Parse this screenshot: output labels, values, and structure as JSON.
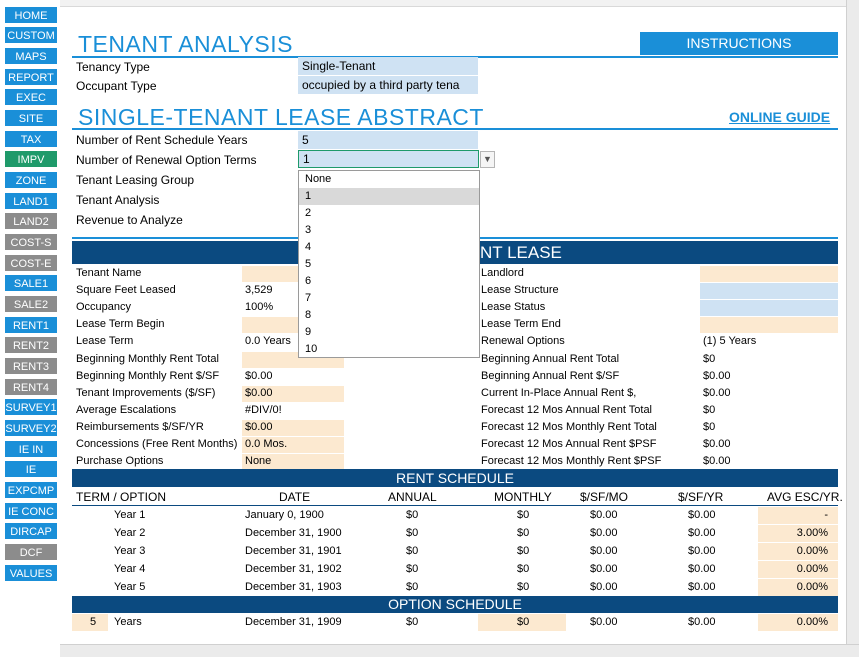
{
  "nav": [
    "HOME",
    "CUSTOM",
    "MAPS",
    "REPORT",
    "EXEC",
    "SITE",
    "TAX",
    "IMPV",
    "ZONE",
    "LAND1",
    "LAND2",
    "COST-S",
    "COST-E",
    "SALE1",
    "SALE2",
    "RENT1",
    "RENT2",
    "RENT3",
    "RENT4",
    "SURVEY1",
    "SURVEY2",
    "IE IN",
    "IE",
    "EXPCMP",
    "IE CONC",
    "DIRCAP",
    "DCF",
    "VALUES"
  ],
  "colors": {
    "accent": "#1a8fd8",
    "band": "#0b4a80",
    "gray": "#8c8c8c",
    "green": "#1f9a6a",
    "input_blue": "#cfe2f3",
    "input_tan": "#fce9d0"
  },
  "tenant_analysis": {
    "title": "TENANT ANALYSIS",
    "instructions": "INSTRUCTIONS",
    "tenancy_type_label": "Tenancy Type",
    "tenancy_type_value": "Single-Tenant",
    "occupant_type_label": "Occupant Type",
    "occupant_type_value": "occupied by a third party tena"
  },
  "abstract": {
    "title": "SINGLE-TENANT LEASE ABSTRACT",
    "online_guide": "ONLINE GUIDE",
    "rent_years_label": "Number of Rent Schedule Years",
    "rent_years_value": "5",
    "renewal_terms_label": "Number of Renewal Option Terms",
    "renewal_terms_value": "1",
    "leasing_group_label": "Tenant Leasing Group",
    "tenant_analysis_label": "Tenant Analysis",
    "revenue_label": "Revenue to Analyze"
  },
  "dropdown": {
    "options": [
      "None",
      "1",
      "2",
      "3",
      "4",
      "5",
      "6",
      "7",
      "8",
      "9",
      "10"
    ],
    "selected": "1"
  },
  "lease_band": "NT LEASE",
  "left_fields": [
    {
      "label": "Tenant Name",
      "value": ""
    },
    {
      "label": "Square Feet Leased",
      "value": "3,529"
    },
    {
      "label": "Occupancy",
      "value": "100%"
    },
    {
      "label": "Lease Term Begin",
      "value": ""
    },
    {
      "label": "Lease Term",
      "value": "0.0 Years"
    },
    {
      "label": "Beginning Monthly Rent Total",
      "value": ""
    },
    {
      "label": "Beginning Monthly Rent $/SF",
      "value": "$0.00"
    },
    {
      "label": "Tenant Improvements ($/SF)",
      "value": "$0.00"
    },
    {
      "label": "Average Escalations",
      "value": "#DIV/0!"
    },
    {
      "label": "Reimbursements $/SF/YR",
      "value": "$0.00"
    },
    {
      "label": "Concessions (Free Rent Months)",
      "value": "0.0 Mos."
    },
    {
      "label": "Purchase Options",
      "value": "None"
    }
  ],
  "right_fields": [
    {
      "label": "Landlord",
      "value": ""
    },
    {
      "label": "Lease Structure",
      "value": ""
    },
    {
      "label": "Lease Status",
      "value": ""
    },
    {
      "label": "Lease Term End",
      "value": ""
    },
    {
      "label": "Renewal Options",
      "value": "(1) 5 Years"
    },
    {
      "label": "Beginning Annual Rent Total",
      "value": "$0"
    },
    {
      "label": "Beginning Annual Rent $/SF",
      "value": "$0.00"
    },
    {
      "label": "Current In-Place Annual Rent $,",
      "value": "$0.00"
    },
    {
      "label": "Forecast 12 Mos Annual Rent Total",
      "value": "$0"
    },
    {
      "label": "Forecast 12 Mos Monthly Rent Total",
      "value": "$0"
    },
    {
      "label": "Forecast 12 Mos Annual Rent $PSF",
      "value": "$0.00"
    },
    {
      "label": "Forecast 12 Mos Monthly Rent $PSF",
      "value": "$0.00"
    }
  ],
  "rent_schedule": {
    "title": "RENT SCHEDULE",
    "headers": [
      "TERM / OPTION",
      "DATE",
      "ANNUAL",
      "MONTHLY",
      "$/SF/MO",
      "$/SF/YR",
      "AVG ESC/YR."
    ],
    "rows": [
      {
        "term": "",
        "label": "Year 1",
        "date": "January 0, 1900",
        "annual": "$0",
        "monthly": "$0",
        "sfmo": "$0.00",
        "sfyr": "$0.00",
        "esc": "-"
      },
      {
        "term": "",
        "label": "Year 2",
        "date": "December 31, 1900",
        "annual": "$0",
        "monthly": "$0",
        "sfmo": "$0.00",
        "sfyr": "$0.00",
        "esc": "3.00%"
      },
      {
        "term": "",
        "label": "Year 3",
        "date": "December 31, 1901",
        "annual": "$0",
        "monthly": "$0",
        "sfmo": "$0.00",
        "sfyr": "$0.00",
        "esc": "0.00%"
      },
      {
        "term": "",
        "label": "Year 4",
        "date": "December 31, 1902",
        "annual": "$0",
        "monthly": "$0",
        "sfmo": "$0.00",
        "sfyr": "$0.00",
        "esc": "0.00%"
      },
      {
        "term": "",
        "label": "Year 5",
        "date": "December 31, 1903",
        "annual": "$0",
        "monthly": "$0",
        "sfmo": "$0.00",
        "sfyr": "$0.00",
        "esc": "0.00%"
      }
    ]
  },
  "option_schedule": {
    "title": "OPTION SCHEDULE",
    "row": {
      "term": "5",
      "label": "Years",
      "date": "December 31, 1909",
      "annual": "$0",
      "monthly": "$0",
      "sfmo": "$0.00",
      "sfyr": "$0.00",
      "esc": "0.00%"
    }
  }
}
